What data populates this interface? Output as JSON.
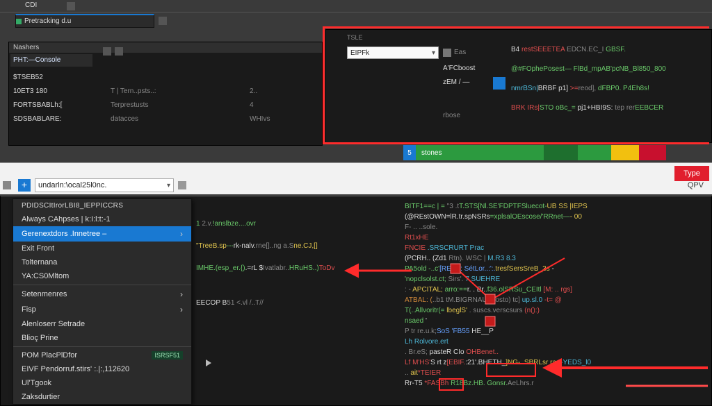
{
  "top_toolbar": {
    "left_label": "CDI",
    "tab": "Pretracking d.u"
  },
  "left_panel": {
    "title": "Nashers",
    "console_label": "PHT:—Console",
    "rows": [
      {
        "a": "$TSEB52",
        "b": "",
        "c": ""
      },
      {
        "a": "10ET3 180",
        "b": "T | Tern..psts..:",
        "c": "2.."
      },
      {
        "a": "FORTSBABLh:[",
        "b": "Terprestusts",
        "c": "4"
      },
      {
        "a": "SDSBABLARE:",
        "b": "datacces",
        "c": "WHIvs"
      }
    ]
  },
  "code_top": {
    "tab_small": "TSLE",
    "dropdown_value": "EIPFk",
    "dropdown_side": "Eas",
    "labels": {
      "a": "A'FCboost",
      "b": "zEM / —",
      "c": "rbose"
    },
    "block_icon_name": "block-icon",
    "lines": [
      [
        {
          "t": "B4 ",
          "c": "white"
        },
        {
          "t": "restSEEETEA",
          "c": "red"
        },
        {
          "t": " EDCN.EC_I",
          "c": "muted"
        },
        {
          "t": " GBSF.",
          "c": "green"
        }
      ],
      [
        {
          "t": "@#FOphePosest—",
          "c": "green"
        },
        {
          "t": " FlBd_mpAB'pcNB_Bl850_800",
          "c": "green"
        }
      ],
      [
        {
          "t": "nmrBSn|",
          "c": "cyan"
        },
        {
          "t": "BRBF p1] ",
          "c": "white"
        },
        {
          "t": ">=",
          "c": "red"
        },
        {
          "t": "reod],  ",
          "c": "muted"
        },
        {
          "t": "dFBP0. P4Eh8s!",
          "c": "green"
        }
      ],
      [
        {
          "t": "BRK IRs|",
          "c": "red"
        },
        {
          "t": "STO  oBc_= ",
          "c": "green"
        },
        {
          "t": "pj1+HBI9S:  ",
          "c": "white"
        },
        {
          "t": "tep rer",
          "c": "muted"
        },
        {
          "t": "EEBCER",
          "c": "green"
        }
      ]
    ]
  },
  "status_bar": {
    "left_badge": "5",
    "seg1": "stones",
    "type_badge": "Type"
  },
  "browser_bar": {
    "address": "undarln:\\ocal25l0nc.",
    "right": "QPV"
  },
  "context_menu": {
    "header": "PDIDSCItIrorLBI8_IEPPICCRS",
    "items": [
      {
        "id": "always-capses",
        "label": "Always CAhpses | k:I:l:t:-1"
      },
      {
        "id": "gere-nextdors",
        "label": "Gerenextdors .Innetree –",
        "selected": true,
        "submenu": true
      },
      {
        "id": "exit-front",
        "label": "Exit Front"
      },
      {
        "id": "tolternana",
        "label": "Tolternana"
      },
      {
        "id": "yacs0mltom",
        "label": "YA:CS0Mltom"
      },
      {
        "id": "__sep1",
        "sep": true
      },
      {
        "id": "setenmenres",
        "label": "Setenmenres",
        "submenu": true
      },
      {
        "id": "fisp",
        "label": "Fisp",
        "submenu": true
      },
      {
        "id": "alenloserr",
        "label": "Alenloserr Setrade"
      },
      {
        "id": "bloa-prine",
        "label": "Blioç  Prine"
      },
      {
        "id": "__sep2",
        "sep": true
      },
      {
        "id": "pom-placr",
        "label": "POM PlacPlDfor",
        "badge": "ISRSF51"
      },
      {
        "id": "eivf-pendor",
        "label": "EIVF Pendorruf.stirs' :.|:,112620"
      },
      {
        "id": "ulp-gook",
        "label": "Ul'Tgook"
      },
      {
        "id": "zaksdurtier",
        "label": "Zaksdurtier"
      }
    ]
  },
  "mid_panel": {
    "lines": [
      [
        {
          "t": "1",
          "c": "green"
        },
        {
          "t": "         2.v.",
          "c": "muted"
        },
        {
          "t": "!anslbze....ovr",
          "c": "green"
        }
      ],
      [
        {
          "t": "\"TreeB.sp",
          "c": "yellow"
        },
        {
          "t": "---",
          "c": "green"
        },
        {
          "t": "rk-nalv.",
          "c": "white"
        },
        {
          "t": "rne[]..ng a.S",
          "c": "muted"
        },
        {
          "t": "ne.CJ,[]",
          "c": "yellow"
        }
      ],
      [
        {
          "t": "IMHE.(esp_er.{)",
          "c": "green"
        },
        {
          "t": ".=rL $",
          "c": "white"
        },
        {
          "t": "Ivatlabr..",
          "c": "muted"
        },
        {
          "t": "HRuHS..)",
          "c": "green"
        },
        {
          "t": "ToDv",
          "c": "red"
        }
      ],
      [
        {
          "t": " ",
          "c": "white"
        }
      ],
      [
        {
          "t": "EECOP B",
          "c": "white"
        },
        {
          "t": "51 <.vl  /..T//",
          "c": "muted"
        }
      ]
    ]
  },
  "right_panel": {
    "lines": [
      [
        {
          "t": "BITF1==c |  = ",
          "c": "green"
        },
        {
          "t": "\"3 .t",
          "c": "muted"
        },
        {
          "t": "T.STS[Nl.SE'FDPTFSluecot-",
          "c": "green"
        },
        {
          "t": "UB SS |IEPS",
          "c": "yellow"
        }
      ],
      [
        {
          "t": "(@REstOWN=lR.tr.spNSRs",
          "c": "white"
        },
        {
          "t": "=xplsalOEscose/'RRnet—",
          "c": "green"
        },
        {
          "t": "-  00",
          "c": "yellow"
        }
      ],
      [
        {
          "t": "F-  ..   ..sole.",
          "c": "muted"
        }
      ],
      [
        {
          "t": "Rt1xHE",
          "c": "red"
        }
      ],
      [
        {
          "t": "FNCIE ",
          "c": "red"
        },
        {
          "t": ".SRSCRURT Prac",
          "c": "cyan"
        }
      ],
      [
        {
          "t": " (PCRH..    (Zd1",
          "c": "white"
        },
        {
          "t": " Rtn).   WSC  | ",
          "c": "muted"
        },
        {
          "t": " M.R3 8.3",
          "c": "cyan"
        }
      ],
      [
        {
          "t": " PA5old -..c'",
          "c": "green"
        },
        {
          "t": "[REBK: SétLor..:':.",
          "c": "blue"
        },
        {
          "t": "tresfSersSreB_3s",
          "c": "yellow"
        },
        {
          "t": " -",
          "c": "white"
        }
      ],
      [
        {
          "t": "  'nopclsolst.ct;  ",
          "c": "green"
        },
        {
          "t": "Sirs'.",
          "c": "muted"
        },
        {
          "t": " 7 SUEHRE",
          "c": "cyan"
        }
      ],
      [
        {
          "t": ": -   ",
          "c": "muted"
        },
        {
          "t": "APCITAL;  ",
          "c": "yellow"
        },
        {
          "t": " arro:==",
          "c": "green"
        },
        {
          "t": "r.  . Br.",
          "c": "white"
        },
        {
          "t": ".f36.olSRSu_CEItl ",
          "c": "green"
        },
        {
          "t": " [M: .. rgs]",
          "c": "red"
        }
      ],
      [
        {
          "t": "ATBAL: (",
          "c": "orange"
        },
        {
          "t": "..b1  tM.BIGRNAU-mosto)  tc]",
          "c": "muted"
        },
        {
          "t": " up.sl.0 ",
          "c": "cyan"
        },
        {
          "t": "-t=  @",
          "c": "red"
        }
      ],
      [
        {
          "t": "  T(..Allvoritr(= ",
          "c": "green"
        },
        {
          "t": "lbeglS' ",
          "c": "yellow"
        },
        {
          "t": ".  suscs.verscsurs  ",
          "c": "muted"
        },
        {
          "t": "(n():)",
          "c": "red"
        }
      ],
      [
        {
          "t": "    nsaed ",
          "c": "green"
        },
        {
          "t": "'",
          "c": "white"
        }
      ],
      [
        {
          "t": "    P  tr re.u.k;",
          "c": "muted"
        },
        {
          "t": "SoS 'FB55",
          "c": "blue"
        },
        {
          "t": " HE__P",
          "c": "white"
        }
      ],
      [
        {
          "t": "Lh Rolvore.ert",
          "c": "cyan"
        }
      ],
      [
        {
          "t": " . Br.eS; ",
          "c": "muted"
        },
        {
          "t": "pasteR CIo   ",
          "c": "white"
        },
        {
          "t": "OHBenet..",
          "c": "red"
        }
      ],
      [
        {
          "t": " Lf M'HS'",
          "c": "red"
        },
        {
          "t": "S rt z",
          "c": "white"
        },
        {
          "t": "[EBIF.",
          "c": "red"
        },
        {
          "t": ":21'.BHETH_",
          "c": "white"
        },
        {
          "t": "]NG-. SBRLsr  ra.",
          "c": "yellow"
        },
        {
          "t": "--YEDS_l0",
          "c": "cyan"
        }
      ],
      [
        {
          "t": " ..     ",
          "c": "muted"
        },
        {
          "t": "ait",
          "c": "yellow"
        },
        {
          "t": "*TEIER",
          "c": "red"
        }
      ],
      [
        {
          "t": "Rr-T5",
          "c": "white"
        },
        {
          "t": " *FASBh   ",
          "c": "red"
        },
        {
          "t": "R18Bz.HB. Gonsr.",
          "c": "green"
        },
        {
          "t": "AeLhrs.r",
          "c": "muted"
        }
      ]
    ],
    "box_labels": {
      "a": "B",
      "b": "EBIF"
    }
  },
  "colors": {
    "accent_blue": "#1979d2",
    "danger_red": "#e11e2d",
    "status_green": "#2c9a3f",
    "status_yellow": "#f2c00f",
    "status_dark": "#3a3a3a",
    "highlight_red": "#ff2b2b"
  }
}
